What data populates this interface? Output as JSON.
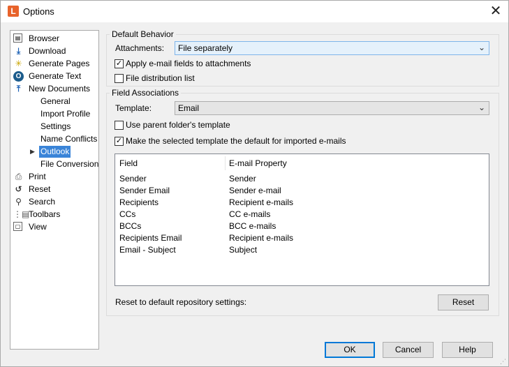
{
  "window": {
    "title": "Options",
    "app_icon_letter": "L"
  },
  "tree": {
    "items": [
      {
        "label": "Browser",
        "icon": "browser-icon"
      },
      {
        "label": "Download",
        "icon": "download-icon"
      },
      {
        "label": "Generate Pages",
        "icon": "generate-pages-icon"
      },
      {
        "label": "Generate Text",
        "icon": "generate-text-icon"
      },
      {
        "label": "New Documents",
        "icon": "new-documents-icon"
      },
      {
        "label": "General"
      },
      {
        "label": "Import Profile"
      },
      {
        "label": "Settings"
      },
      {
        "label": "Name Conflicts"
      },
      {
        "label": "Outlook"
      },
      {
        "label": "File Conversion"
      },
      {
        "label": "Print",
        "icon": "print-icon"
      },
      {
        "label": "Reset",
        "icon": "reset-icon"
      },
      {
        "label": "Search",
        "icon": "search-icon"
      },
      {
        "label": "Toolbars",
        "icon": "toolbars-icon"
      },
      {
        "label": "View",
        "icon": "view-icon"
      }
    ],
    "selected": "Outlook"
  },
  "default_behavior": {
    "title": "Default Behavior",
    "attachments_label": "Attachments:",
    "attachments_value": "File separately",
    "apply_fields_label": "Apply e-mail fields to attachments",
    "apply_fields_checked": true,
    "distribution_label": "File distribution list",
    "distribution_checked": false
  },
  "field_associations": {
    "title": "Field Associations",
    "template_label": "Template:",
    "template_value": "Email",
    "use_parent_label": "Use parent folder's template",
    "use_parent_checked": false,
    "make_default_label": "Make the selected template the default for imported e-mails",
    "make_default_checked": true,
    "table": {
      "headers": [
        "Field",
        "E-mail Property"
      ],
      "rows": [
        [
          "Sender",
          "Sender"
        ],
        [
          "Sender Email",
          "Sender e-mail"
        ],
        [
          "Recipients",
          "Recipient e-mails"
        ],
        [
          "CCs",
          "CC e-mails"
        ],
        [
          "BCCs",
          "BCC e-mails"
        ],
        [
          "Recipients Email",
          "Recipient e-mails"
        ],
        [
          "Email - Subject",
          "Subject"
        ]
      ]
    },
    "reset_label": "Reset to default repository settings:",
    "reset_button": "Reset"
  },
  "footer": {
    "ok": "OK",
    "cancel": "Cancel",
    "help": "Help"
  },
  "icons": {
    "close": "close-icon",
    "expander": "chevron-right-icon",
    "dropdown": "chevron-down-icon",
    "check": "check-icon"
  }
}
